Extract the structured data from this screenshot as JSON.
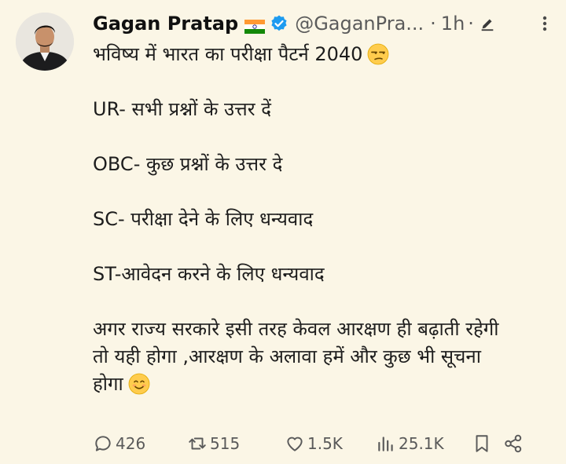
{
  "author": {
    "name": "Gagan Pratap",
    "handle": "@GaganPra...",
    "separator": "·",
    "time": "1h",
    "separator2": "·"
  },
  "tweet": {
    "line1": "भविष्य में भारत का परीक्षा पैटर्न 2040",
    "line2": "UR- सभी प्रश्नों के उत्तर दें",
    "line3": "OBC- कुछ प्रश्नों के उत्तर दे",
    "line4": "SC- परीक्षा देने के लिए धन्यवाद",
    "line5": "ST-आवेदन करने के लिए धन्यवाद",
    "line6": "अगर राज्य सरकारे इसी तरह केवल आरक्षण ही बढ़ाती रहेगी",
    "line7": "तो यही होगा ,आरक्षण के अलावा हमें और कुछ भी सूचना",
    "line8": "होगा"
  },
  "actions": {
    "replies": "426",
    "retweets": "515",
    "likes": "1.5K",
    "views": "25.1K"
  },
  "colors": {
    "background": "#fbf6e6",
    "verified": "#1d9bf0",
    "icon": "#5a5a5a"
  }
}
